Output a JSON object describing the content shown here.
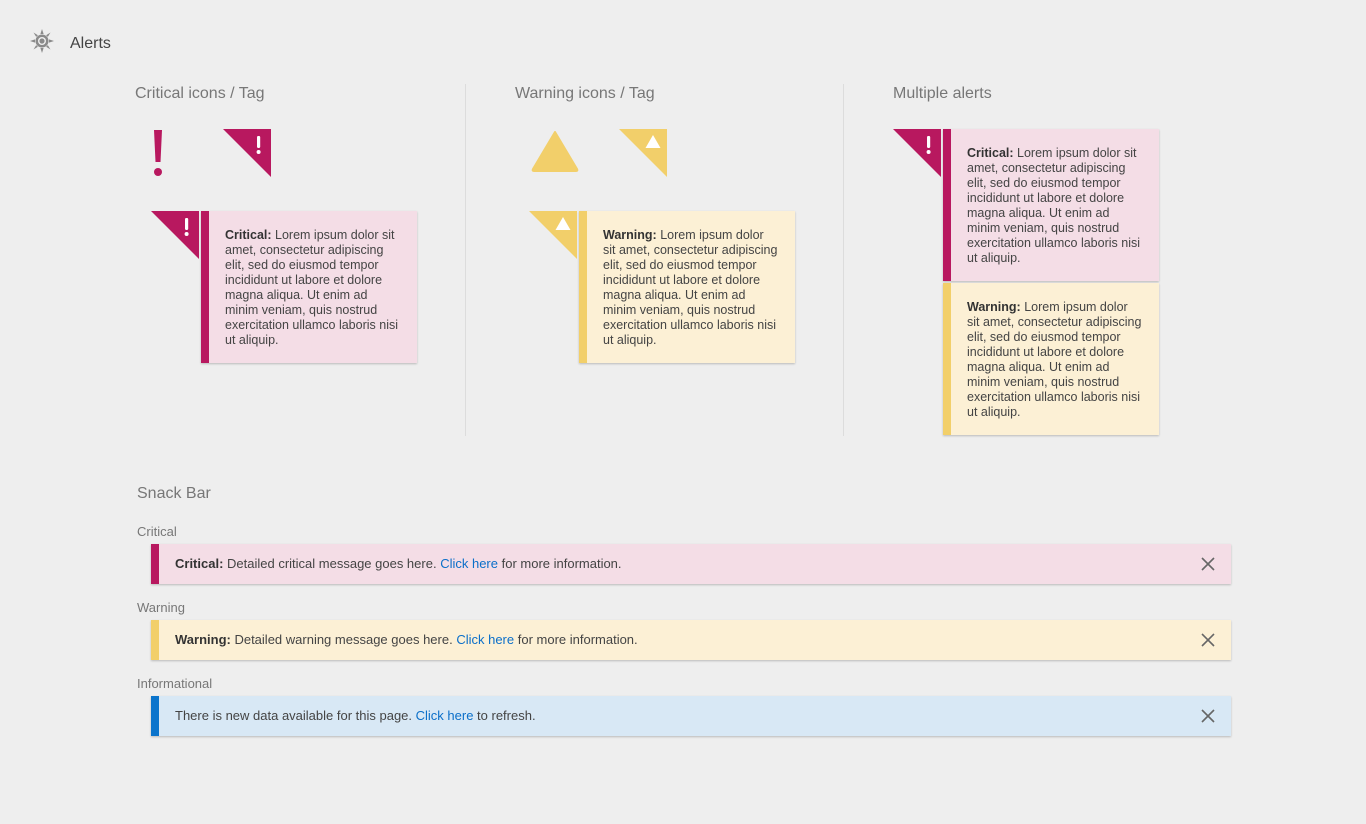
{
  "header": {
    "title": "Alerts",
    "icon": "sun-gear-icon"
  },
  "colors": {
    "critical": "#b8185f",
    "critical_bg": "#f4dde6",
    "warning": "#f2cf6a",
    "warning_bg": "#fcf0d5",
    "info": "#0b74cc",
    "info_bg": "#d8e8f5",
    "link": "#0b6fc9"
  },
  "critical_section": {
    "title": "Critical icons / Tag",
    "card": {
      "label": "Critical:",
      "body": "Lorem ipsum dolor sit amet, consectetur adipiscing elit, sed do eiusmod tempor incididunt ut labore et dolore magna aliqua. Ut enim ad minim veniam, quis nostrud exercitation ullamco laboris nisi ut aliquip."
    }
  },
  "warning_section": {
    "title": "Warning icons / Tag",
    "card": {
      "label": "Warning:",
      "body": "Lorem ipsum dolor sit amet, consectetur adipiscing elit, sed do eiusmod tempor incididunt ut labore et dolore magna aliqua. Ut enim ad minim veniam, quis nostrud exercitation ullamco laboris nisi ut aliquip."
    }
  },
  "multiple_section": {
    "title": "Multiple alerts",
    "critical": {
      "label": "Critical:",
      "body": "Lorem ipsum dolor sit amet, consectetur adipiscing elit, sed do eiusmod tempor incididunt ut labore et dolore magna aliqua. Ut enim ad minim veniam, quis nostrud exercitation ullamco laboris nisi ut aliquip."
    },
    "warning": {
      "label": "Warning:",
      "body": "Lorem ipsum dolor sit amet, consectetur adipiscing elit, sed do eiusmod tempor incididunt ut labore et dolore magna aliqua. Ut enim ad minim veniam, quis nostrud exercitation ullamco laboris nisi ut aliquip."
    }
  },
  "snackbar": {
    "title": "Snack Bar",
    "critical": {
      "label": "Critical",
      "bold": "Critical:",
      "pre": " Detailed critical message goes here. ",
      "link": "Click here",
      "post": " for more information."
    },
    "warning": {
      "label": "Warning",
      "bold": "Warning:",
      "pre": " Detailed warning message goes here. ",
      "link": "Click here",
      "post": " for more information."
    },
    "info": {
      "label": "Informational",
      "pre": "There is new data available for this page. ",
      "link": "Click here",
      "post": " to refresh."
    }
  }
}
